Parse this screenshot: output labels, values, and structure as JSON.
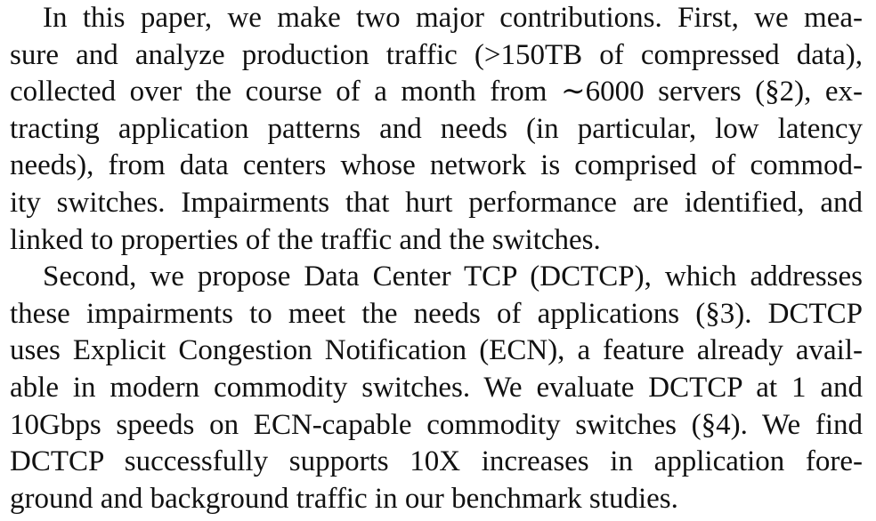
{
  "paragraphs": [
    {
      "lines": [
        "In this paper, we make two major contributions. First, we mea-",
        "sure and analyze production traffic (>150TB of compressed data),",
        "collected over the course of a month from ∼6000 servers (§2), ex-",
        "tracting application patterns and needs (in particular, low latency",
        "needs), from data centers whose network is comprised of commod-",
        "ity switches. Impairments that hurt performance are identified, and",
        "linked to properties of the traffic and the switches."
      ]
    },
    {
      "lines": [
        "Second, we propose Data Center TCP (DCTCP), which addresses",
        "these impairments to meet the needs of applications (§3). DCTCP",
        "uses Explicit Congestion Notification (ECN), a feature already avail-",
        "able in modern commodity switches. We evaluate DCTCP at 1 and",
        "10Gbps speeds on ECN-capable commodity switches (§4). We find",
        "DCTCP successfully supports 10X increases in application fore-",
        "ground and background traffic in our benchmark studies."
      ]
    }
  ]
}
